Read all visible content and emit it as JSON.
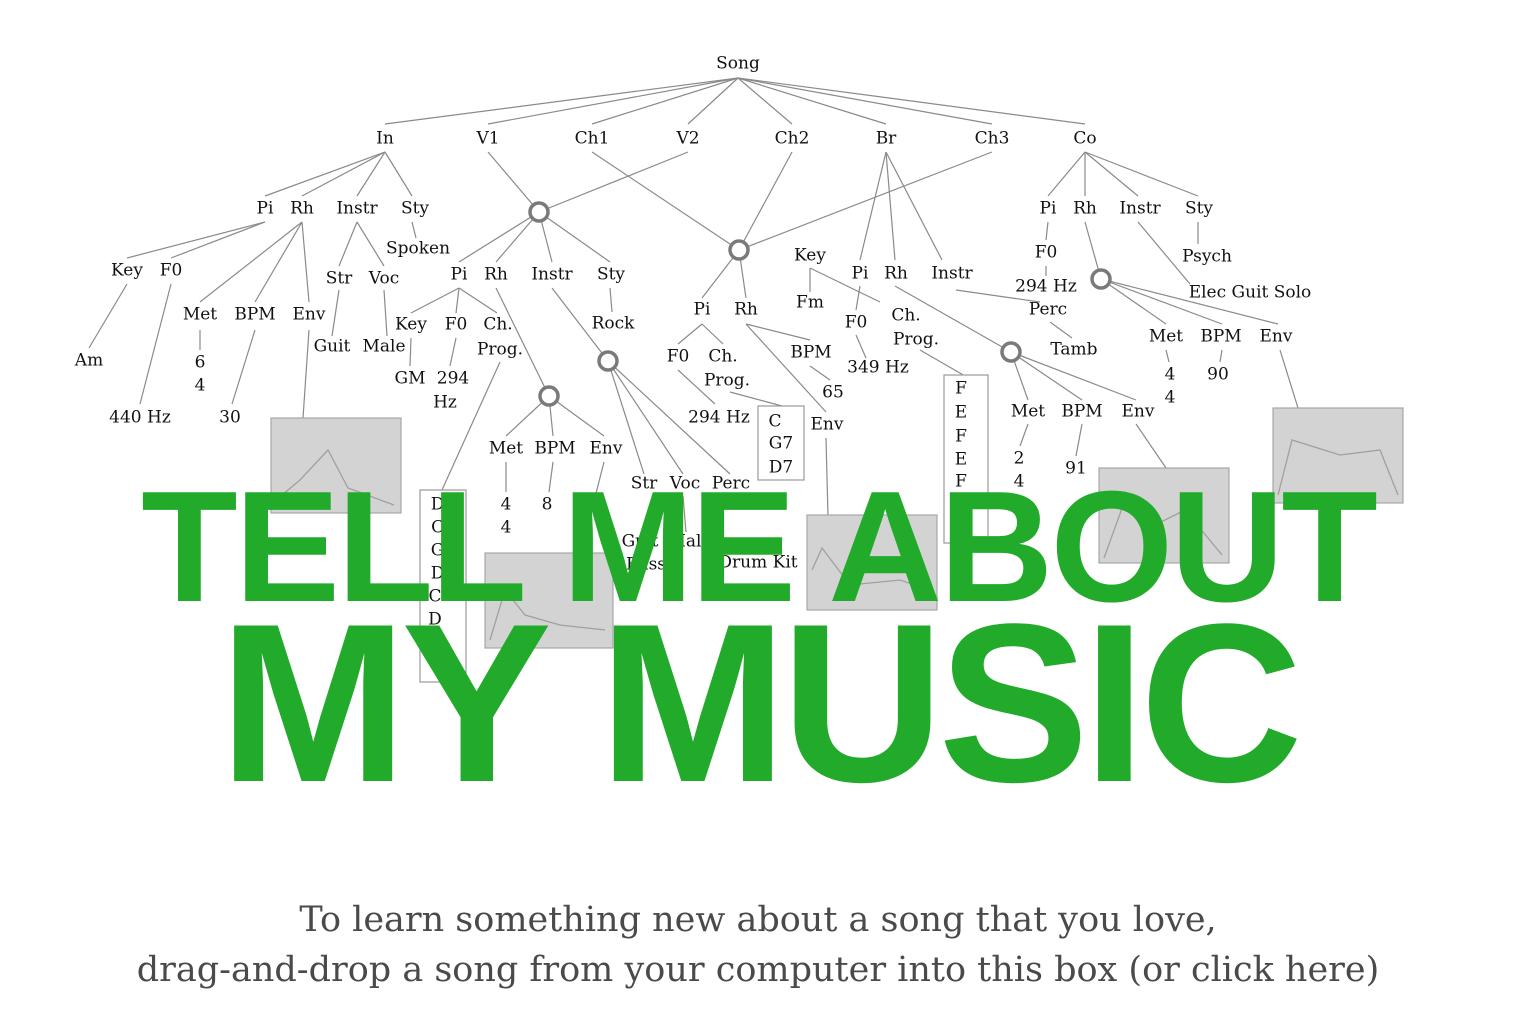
{
  "colors": {
    "headline": "#22ab2a",
    "instruction_text": "#4a4a4a",
    "tree_line": "#8a8a8a",
    "envelope_box": "#d3d3d3"
  },
  "headline": {
    "line1": "TELL ME ABOUT",
    "line2": "MY MUSIC"
  },
  "instructions": {
    "line1": "To learn something new about a song that you love,",
    "line2": "drag-and-drop a song from your computer into this box (or click here)"
  },
  "tree": {
    "root": "Song",
    "sections": [
      "In",
      "V1",
      "Ch1",
      "V2",
      "Ch2",
      "Br",
      "Ch3",
      "Co"
    ],
    "intro": {
      "children": [
        "Pi",
        "Rh",
        "Instr",
        "Sty"
      ],
      "pitch": [
        "Key",
        "F0"
      ],
      "key": "Am",
      "f0": "440 Hz",
      "rhythm": [
        "Met",
        "BPM",
        "Env"
      ],
      "meter": [
        "6",
        "4"
      ],
      "bpm": "30",
      "instr": [
        "Str",
        "Voc"
      ],
      "str": "Guit",
      "voc": "Male",
      "style": "Spoken"
    },
    "verse": {
      "children": [
        "Pi",
        "Rh",
        "Instr",
        "Sty"
      ],
      "pitch": [
        "Key",
        "F0",
        "Ch.",
        "Prog."
      ],
      "key": "GM",
      "f0": [
        "294",
        "Hz"
      ],
      "progression": [
        "D7",
        "C7",
        "G7",
        "D7",
        "C",
        "D"
      ],
      "rhythm": [
        "Met",
        "BPM",
        "Env"
      ],
      "meter": [
        "4",
        "4"
      ],
      "bpm": "8",
      "instr": [
        "Str",
        "Voc",
        "Perc"
      ],
      "str": "Guit",
      "str2": "Bass",
      "voc": "Male",
      "perc": "Drum Kit",
      "style": "Rock"
    },
    "chorus": {
      "children": [
        "Pi",
        "Rh"
      ],
      "pitch": [
        "F0",
        "Ch.",
        "Prog."
      ],
      "f0": "294 Hz",
      "progression": [
        "C",
        "G7",
        "D7"
      ],
      "rhythm": [
        "BPM",
        "Env"
      ],
      "bpm": "65"
    },
    "bridge": {
      "children": [
        "Key",
        "Pi",
        "Rh",
        "Instr"
      ],
      "key": "Fm",
      "pitch": [
        "F0",
        "Ch.",
        "Prog."
      ],
      "f0": "349 Hz",
      "progression": [
        "F",
        "E",
        "F",
        "E",
        "F"
      ],
      "rhythm": [
        "Met",
        "BPM",
        "Env"
      ],
      "meter": [
        "2",
        "4"
      ],
      "bpm": "91"
    },
    "coda": {
      "children": [
        "Pi",
        "Rh",
        "Instr",
        "Sty"
      ],
      "pitch": [
        "F0"
      ],
      "f0": "294 Hz",
      "instr": [
        "Perc"
      ],
      "perc": "Tamb",
      "rhythm": [
        "Met",
        "BPM",
        "Env"
      ],
      "meter": [
        "4",
        "4"
      ],
      "bpm": "90",
      "style": [
        "Psych",
        "Elec Guit Solo"
      ]
    }
  }
}
